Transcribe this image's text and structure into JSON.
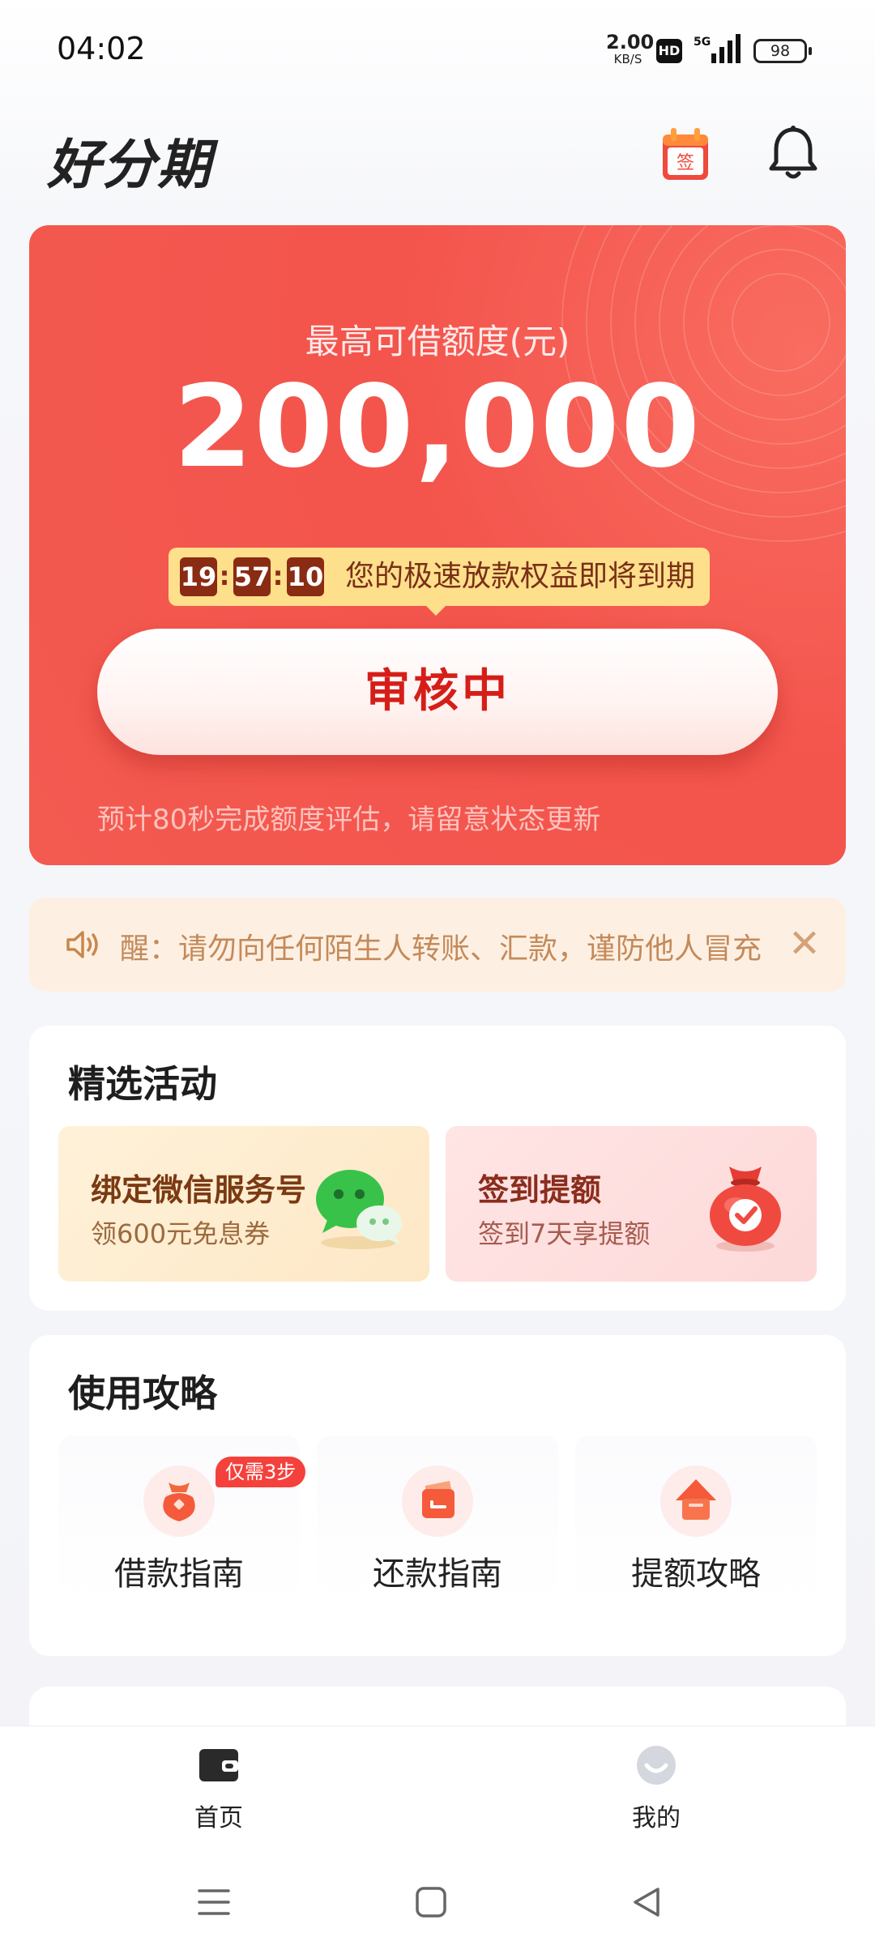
{
  "status_bar": {
    "time": "04:02",
    "network_speed": "2.00",
    "network_unit": "KB/S",
    "hd": "HD",
    "signal": "5G",
    "battery": "98"
  },
  "header": {
    "logo": "好分期",
    "sign_badge": "签",
    "icons": [
      "calendar-sign-icon",
      "bell-icon"
    ]
  },
  "hero": {
    "label": "最高可借额度(元)",
    "amount": "200,000",
    "countdown": {
      "h": "19",
      "m": "57",
      "s": "10",
      "sep": ":",
      "text": "您的极速放款权益即将到期"
    },
    "status_button": "审核中",
    "note": "预计80秒完成额度评估，请留意状态更新"
  },
  "notice": {
    "text": "醒：请勿向任何陌生人转账、汇款，谨防他人冒充",
    "close": "✕"
  },
  "activities": {
    "title": "精选活动",
    "items": [
      {
        "title": "绑定微信服务号",
        "subtitle": "领600元免息券",
        "icon": "wechat-icon"
      },
      {
        "title": "签到提额",
        "subtitle": "签到7天享提额",
        "icon": "red-pouch-check-icon"
      }
    ]
  },
  "guides": {
    "title": "使用攻略",
    "items": [
      {
        "label": "借款指南",
        "badge": "仅需3步",
        "icon": "money-bag-icon"
      },
      {
        "label": "还款指南",
        "icon": "wallet-return-icon"
      },
      {
        "label": "提额攻略",
        "icon": "arrow-up-home-icon"
      }
    ]
  },
  "tabbar": {
    "items": [
      {
        "label": "首页",
        "icon": "wallet-tab-icon",
        "active": true
      },
      {
        "label": "我的",
        "icon": "profile-tab-icon",
        "active": false
      }
    ]
  },
  "colors": {
    "hero_red": "#f3544c",
    "countdown_yellow": "#fddf8c",
    "status_red": "#d61e19",
    "notice_bg": "#fdf0e3"
  }
}
